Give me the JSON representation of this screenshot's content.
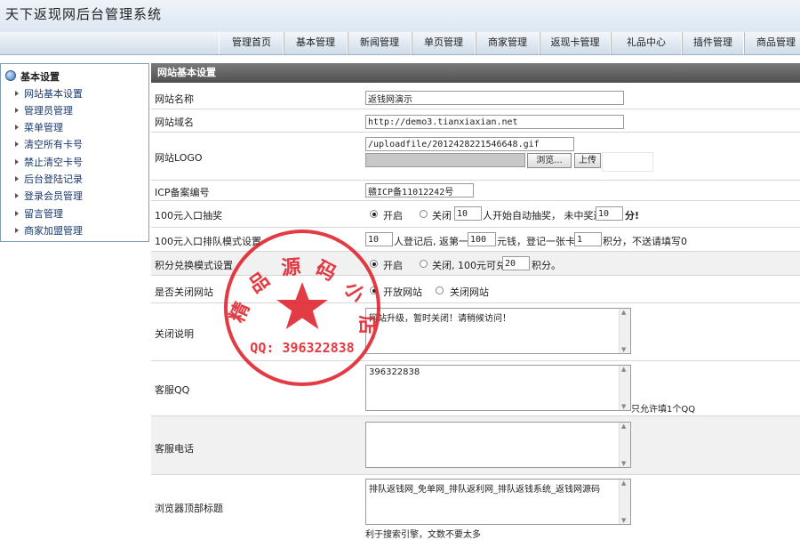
{
  "app": {
    "title": "天下返现网后台管理系统"
  },
  "nav": [
    "管理首页",
    "基本管理",
    "新闻管理",
    "单页管理",
    "商家管理",
    "返现卡管理",
    "礼品中心",
    "插件管理",
    "商品管理"
  ],
  "sidebar": {
    "heading": "基本设置",
    "items": [
      "网站基本设置",
      "管理员管理",
      "菜单管理",
      "清空所有卡号",
      "禁止清空卡号",
      "后台登陆记录",
      "登录会员管理",
      "留言管理",
      "商家加盟管理"
    ]
  },
  "panel": {
    "title": "网站基本设置"
  },
  "form": {
    "site_name": {
      "label": "网站名称",
      "value": "返钱网演示"
    },
    "site_domain": {
      "label": "网站域名",
      "value": "http://demo3.tianxiaxian.net"
    },
    "site_logo": {
      "label": "网站LOGO",
      "value": "/uploadfile/2012428221546648.gif",
      "browse": "浏览...",
      "upload": "上传"
    },
    "icp": {
      "label": "ICP备案编号",
      "value": "赣ICP备11012242号"
    },
    "lottery": {
      "label": "100元入口抽奖",
      "on": "开启",
      "off": "关闭",
      "count": "10",
      "text1": "人开始自动抽奖， 未中奖送",
      "points": "10",
      "text2": "分!"
    },
    "queue": {
      "label": "100元入口排队模式设置",
      "people": "10",
      "t1": "人登记后, 返第一人",
      "amount": "100",
      "t2": "元钱，登记一张卡送",
      "card_points": "1",
      "t3": "积分，不送请填写0"
    },
    "exchange": {
      "label": "积分兑换模式设置",
      "on": "开启",
      "off": "关闭, 100元可兑换",
      "points": "20",
      "unit": "积分。"
    },
    "close_site": {
      "label": "是否关闭网站",
      "open": "开放网站",
      "close": "关闭网站"
    },
    "close_note": {
      "label": "关闭说明",
      "value": "网站升级，暂时关闭！请稍候访问！"
    },
    "qq": {
      "label": "客服QQ",
      "value": "396322838",
      "hint": "只允许填1个QQ"
    },
    "phone": {
      "label": "客服电话",
      "value": ""
    },
    "browser_title": {
      "label": "浏览器顶部标题",
      "value": "排队返钱网_免单网_排队返利网_排队返钱系统_返钱网源码",
      "hint": "利于搜索引擎，文数不要太多"
    }
  },
  "stamp": {
    "ring": "精品源码小店",
    "qq": "QQ: 396322838",
    "color": "#e0202a"
  }
}
